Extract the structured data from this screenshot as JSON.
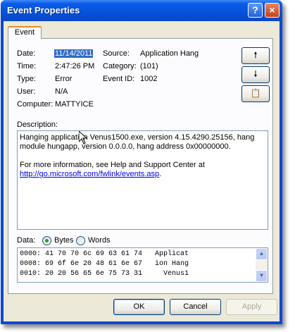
{
  "window": {
    "title": "Event Properties"
  },
  "tabs": [
    {
      "label": "Event"
    }
  ],
  "fields": {
    "date_label": "Date:",
    "date_value": "11/14/2011",
    "time_label": "Time:",
    "time_value": "2:47:26 PM",
    "type_label": "Type:",
    "type_value": "Error",
    "user_label": "User:",
    "user_value": "N/A",
    "computer_label": "Computer:",
    "computer_value": "MATTYICE",
    "source_label": "Source:",
    "source_value": "Application Hang",
    "category_label": "Category:",
    "category_value": "(101)",
    "eventid_label": "Event ID:",
    "eventid_value": "1002"
  },
  "description": {
    "label": "Description:",
    "line1": "Hanging application Venus1500.exe, version 4.15.4290.25156, hang",
    "line2": "module hungapp, version 0.0.0.0, hang address 0x00000000.",
    "line3": "For more information, see Help and Support Center at",
    "link": "http://go.microsoft.com/fwlink/events.asp",
    "link_suffix": "."
  },
  "data": {
    "label": "Data:",
    "bytes_label": "Bytes",
    "words_label": "Words",
    "selected": "Bytes",
    "rows": [
      "0000: 41 70 70 6c 69 63 61 74   Applicat",
      "0008: 69 6f 6e 20 48 61 6e 67   ion Hang",
      "0010: 20 20 56 65 6e 75 73 31     Venus1"
    ]
  },
  "buttons": {
    "ok": "OK",
    "cancel": "Cancel",
    "apply": "Apply"
  },
  "icons": {
    "prev": "up-arrow-icon",
    "next": "down-arrow-icon",
    "copy": "copy-icon",
    "help": "?",
    "close": "×"
  }
}
